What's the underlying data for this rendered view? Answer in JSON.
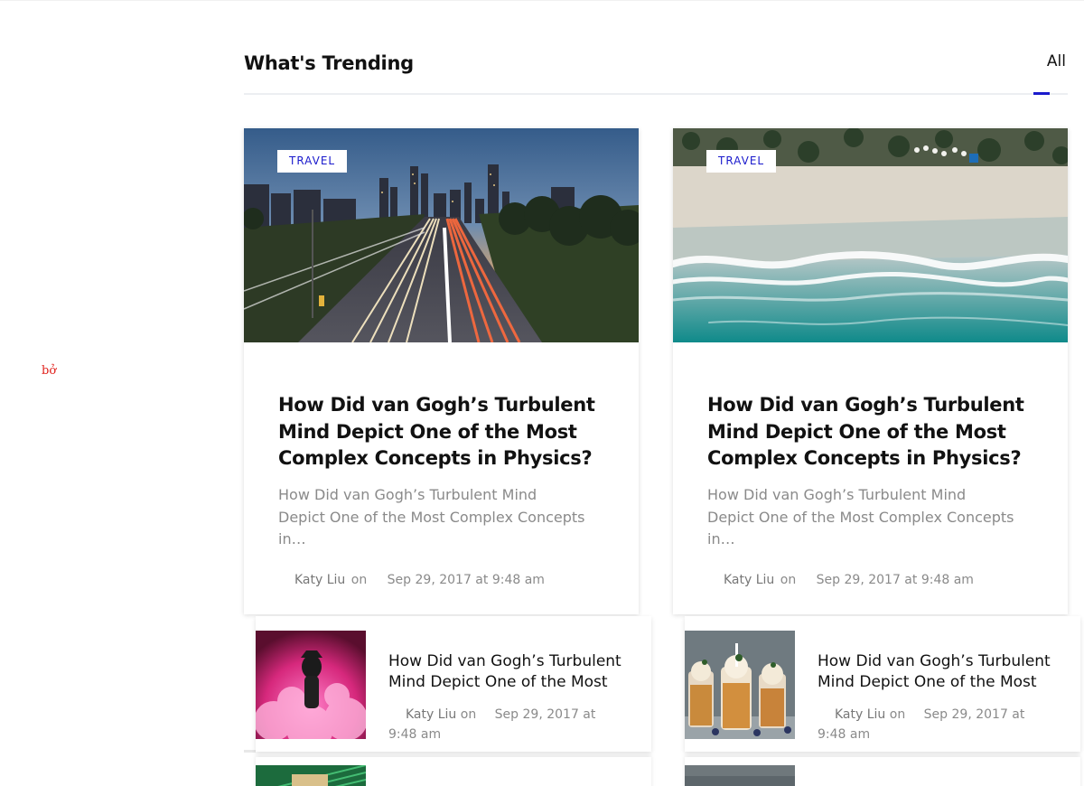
{
  "stray_text": "bở",
  "trending": {
    "title": "What's Trending",
    "tab_all": "All"
  },
  "cards": [
    {
      "category": "TRAVEL",
      "title": "How Did van Gogh’s Turbulent Mind Depict One of the Most Complex Concepts in Physics?",
      "excerpt": "How Did van Gogh’s Turbulent Mind Depict One of the Most Complex Concepts in…",
      "author": "Katy Liu",
      "on": "on",
      "date": "Sep 29, 2017 at 9:48 am"
    },
    {
      "category": "TRAVEL",
      "title": "How Did van Gogh’s Turbulent Mind Depict One of the Most Complex Concepts in Physics?",
      "excerpt": "How Did van Gogh’s Turbulent Mind Depict One of the Most Complex Concepts in…",
      "author": "Katy Liu",
      "on": "on",
      "date": "Sep 29, 2017 at 9:48 am"
    }
  ],
  "mini_posts": [
    {
      "title": "How Did van Gogh’s Turbulent Mind Depict One of the Most",
      "author": "Katy Liu",
      "on": "on",
      "date": "Sep 29, 2017 at 9:48 am"
    },
    {
      "title": "How Did van Gogh’s Turbulent Mind Depict One of the Most",
      "author": "Katy Liu",
      "on": "on",
      "date": "Sep 29, 2017 at 9:48 am"
    }
  ],
  "colors": {
    "accent": "#1a1acc",
    "text": "#111111",
    "muted": "#8a8a8a",
    "stray": "#e0201b"
  }
}
